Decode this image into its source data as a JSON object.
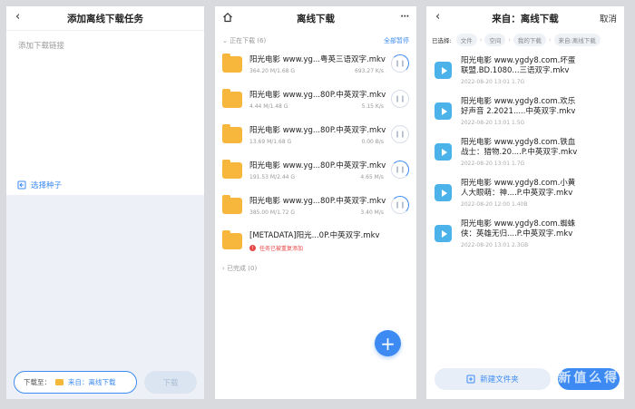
{
  "panel1": {
    "title": "添加离线下载任务",
    "link_placeholder": "添加下载链接",
    "seed_label": "选择种子",
    "dest_prefix": "下载至：",
    "dest_value": "来自：离线下载",
    "download_label": "下载"
  },
  "panel2": {
    "title": "离线下载",
    "section_downloading": "正在下载 (6)",
    "pause_all": "全部暂停",
    "items": [
      {
        "name": "阳光电影 www.yg...粤英三语双字.mkv",
        "size": "364.20 M/1.68 G",
        "speed": "693.27 K/s"
      },
      {
        "name": "阳光电影 www.yg...80P.中英双字.mkv",
        "size": "4.44 M/1.48 G",
        "speed": "5.15 K/s"
      },
      {
        "name": "阳光电影 www.yg...80P.中英双字.mkv",
        "size": "13.69 M/1.68 G",
        "speed": "0.00 B/s"
      },
      {
        "name": "阳光电影 www.yg...80P.中英双字.mkv",
        "size": "191.53 M/2.44 G",
        "speed": "4.65 M/s"
      },
      {
        "name": "阳光电影 www.yg...80P.中英双字.mkv",
        "size": "385.00 M/1.72 G",
        "speed": "3.40 M/s"
      }
    ],
    "metadata_item": {
      "name": "[METADATA]阳光...0P.中英双字.mkv",
      "error": "任务已被重复添加"
    },
    "section_done": "已完成 (0)",
    "fab": "+"
  },
  "panel3": {
    "title": "来自：离线下载",
    "cancel": "取消",
    "selected_label": "已选择:",
    "crumbs": [
      "文件",
      "空间",
      "我的下载",
      "来自:离线下载"
    ],
    "files": [
      {
        "line1": "阳光电影 www.ygdy8.com.坏蛋",
        "line2": "联盟.BD.1080...三语双字.mkv",
        "meta": "2022-08-20 13:01  1.7G"
      },
      {
        "line1": "阳光电影 www.ygdy8.com.欢乐",
        "line2": "好声音 2.2021.....中英双字.mkv",
        "meta": "2022-08-20 13:01  1.5G"
      },
      {
        "line1": "阳光电影 www.ygdy8.com.铁血",
        "line2": "战士：猎物.20....P.中英双字.mkv",
        "meta": "2022-08-20 13:01  1.7G"
      },
      {
        "line1": "阳光电影 www.ygdy8.com.小黄",
        "line2": "人大眼萌：神....P.中英双字.mkv",
        "meta": "2022-08-20 12:00  1.40B"
      },
      {
        "line1": "阳光电影 www.ygdy8.com.蜘蛛",
        "line2": "侠：英雄无归....P.中英双字.mkv",
        "meta": "2022-08-20 13:01  2.3GB"
      }
    ],
    "new_folder": "新建文件夹",
    "watermark": "新 值 么 得"
  },
  "colors": {
    "accent": "#3d8bf2",
    "folder": "#f6b73c",
    "video": "#4cb3ea",
    "error": "#e84747"
  }
}
